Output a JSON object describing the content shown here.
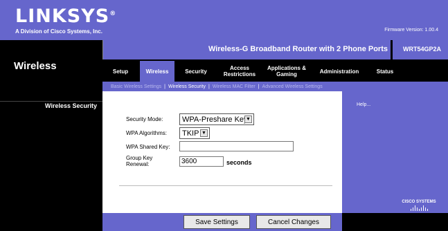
{
  "brand": {
    "logo": "LINKSYS",
    "registered": "®",
    "subtitle": "A Division of Cisco Systems, Inc."
  },
  "firmware": "Firmware Version: 1.00.4",
  "section_title": "Wireless",
  "model": {
    "name": "Wireless-G Broadband Router with 2 Phone Ports",
    "number": "WRT54GP2A"
  },
  "tabs": [
    {
      "label": "Setup",
      "active": false
    },
    {
      "label": "Wireless",
      "active": true
    },
    {
      "label": "Security",
      "active": false
    },
    {
      "label": "Access Restrictions",
      "active": false
    },
    {
      "label": "Applications & Gaming",
      "active": false
    },
    {
      "label": "Administration",
      "active": false
    },
    {
      "label": "Status",
      "active": false
    }
  ],
  "subnav": [
    "Basic Wireless Settings",
    "Wireless Security",
    "Wireless MAC Filter",
    "Advanced Wireless Settings"
  ],
  "subnav_current": "Wireless Security",
  "left_heading": "Wireless Security",
  "form": {
    "security_mode_label": "Security Mode:",
    "security_mode_value": "WPA-Preshare Key",
    "wpa_algorithms_label": "WPA Algorithms:",
    "wpa_algorithms_value": "TKIP",
    "shared_key_label": "WPA Shared Key:",
    "shared_key_value": "",
    "group_key_label_1": "Group Key",
    "group_key_label_2": "Renewal:",
    "group_key_value": "3600",
    "group_key_unit": "seconds"
  },
  "help": "Help...",
  "cisco": "Cisco Systems",
  "buttons": {
    "save": "Save Settings",
    "cancel": "Cancel Changes"
  },
  "colors": {
    "brand_blue": "#6666cc",
    "black": "#000000"
  }
}
